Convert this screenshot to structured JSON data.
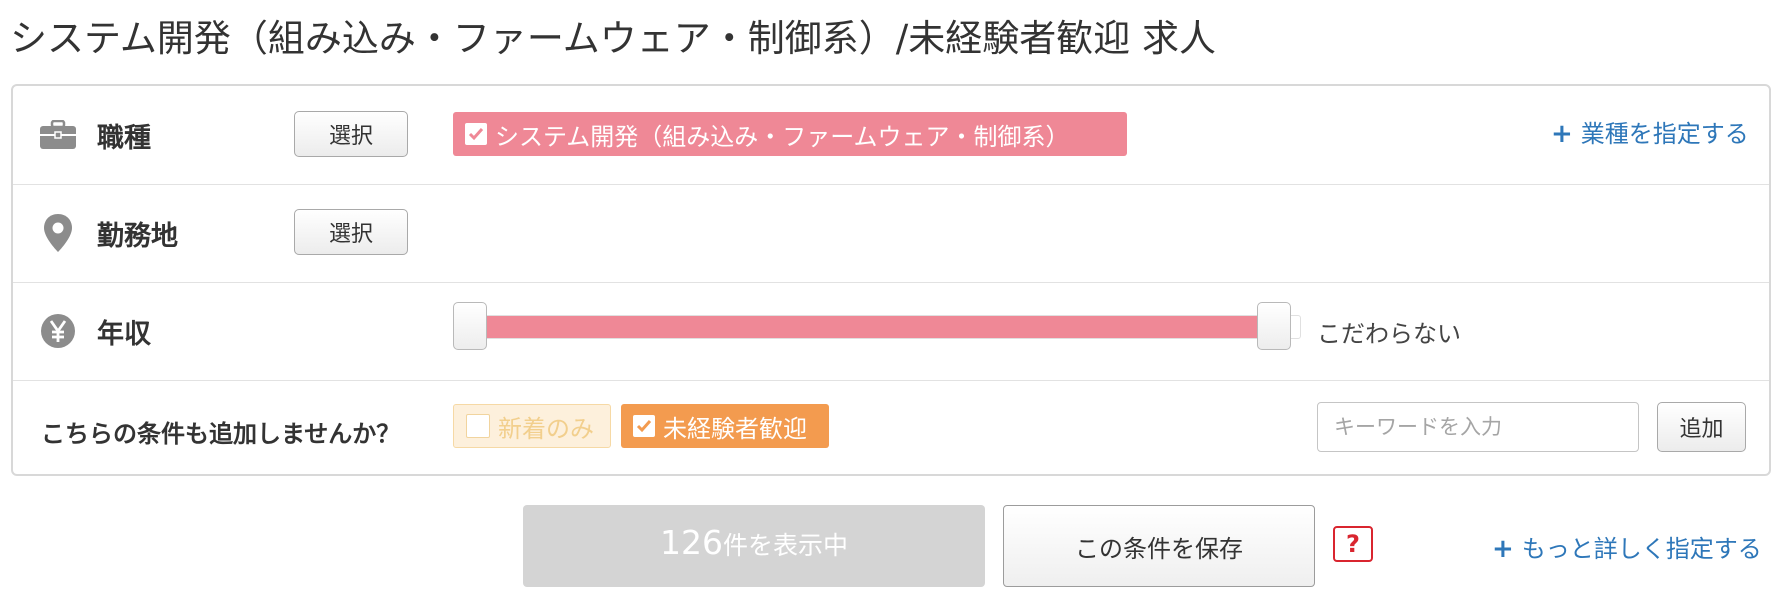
{
  "page": {
    "title": "システム開発（組み込み・ファームウェア・制御系）/未経験者歓迎 求人"
  },
  "rows": {
    "job": {
      "label": "職種",
      "icon": "briefcase-icon",
      "select_label": "選択",
      "chip_label": "システム開発（組み込み・ファームウェア・制御系）",
      "chip_checked": true,
      "industry_link": "業種を指定する"
    },
    "location": {
      "label": "勤務地",
      "icon": "map-pin-icon",
      "select_label": "選択"
    },
    "salary": {
      "label": "年収",
      "icon": "yen-icon",
      "value_text": "こだわらない"
    },
    "extra": {
      "label": "こちらの条件も追加しませんか？",
      "new_only_label": "新着のみ",
      "new_only_checked": false,
      "inexperienced_label": "未経験者歓迎",
      "inexperienced_checked": true,
      "keyword_value": "",
      "keyword_placeholder": "キーワードを入力",
      "add_label": "追加"
    }
  },
  "footer": {
    "count": "126",
    "count_suffix": "件を表示中",
    "save_label": "この条件を保存",
    "help_label": "?",
    "more_link": "もっと詳しく指定する"
  },
  "colors": {
    "accent_pink": "#ef8896",
    "accent_orange": "#f39b4f",
    "link_blue": "#2e77b9",
    "help_red": "#d9252f",
    "disabled_gray": "#d4d4d4"
  }
}
